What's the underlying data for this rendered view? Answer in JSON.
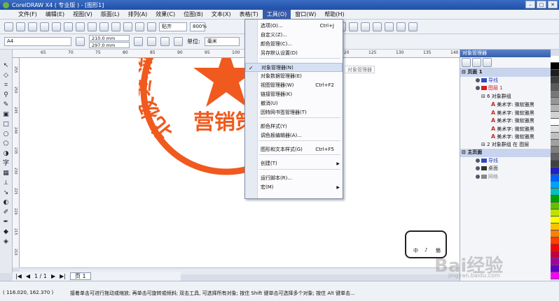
{
  "window": {
    "title": "CorelDRAW X4 ( 专业版 ) - [图形1]"
  },
  "menubar": {
    "items": [
      {
        "label": "文件(F)"
      },
      {
        "label": "编辑(E)"
      },
      {
        "label": "视图(V)"
      },
      {
        "label": "版面(L)"
      },
      {
        "label": "排列(A)"
      },
      {
        "label": "效果(C)"
      },
      {
        "label": "位图(B)"
      },
      {
        "label": "文本(X)"
      },
      {
        "label": "表格(T)"
      },
      {
        "label": "工具(O)"
      },
      {
        "label": "窗口(W)"
      },
      {
        "label": "帮助(H)"
      }
    ]
  },
  "toolbar": {
    "snap_label": "贴齐",
    "zoom": "800%"
  },
  "property_bar": {
    "paper_size": "A4",
    "width": "210.0 mm",
    "height": "297.0 mm",
    "unit_label": "单位:",
    "unit_value": "毫米"
  },
  "ruler": {
    "top_ticks": [
      "65",
      "70",
      "75",
      "80",
      "85",
      "90",
      "95",
      "100",
      "105",
      "110",
      "115",
      "120",
      "125",
      "130",
      "135",
      "140"
    ],
    "left_ticks": [
      "255",
      "250",
      "245",
      "240",
      "235",
      "230",
      "225",
      "220",
      "215",
      "210"
    ]
  },
  "stamp": {
    "arc_text": "北极寒流服务",
    "bottom_text": "营销策划",
    "color": "#f05a1e"
  },
  "tools_menu": {
    "items": [
      {
        "label": "选项(O)...",
        "shortcut": "Ctrl+J"
      },
      {
        "label": "自定义(Z)..."
      },
      {
        "label": "颜色管理(C)..."
      },
      {
        "label": "另存默认设置(D)"
      },
      {
        "label": "对象管理器(N)",
        "checked": true
      },
      {
        "label": "对象数据管理器(E)"
      },
      {
        "label": "视图管理器(W)",
        "shortcut": "Ctrl+F2"
      },
      {
        "label": "链接管理器(K)"
      },
      {
        "label": "撤消(U)"
      },
      {
        "label": "因特网书签管理器(T)"
      },
      {
        "label": "颜色样式(Y)"
      },
      {
        "label": "调色板编辑器(A)..."
      },
      {
        "label": "图形和文本样式(G)",
        "shortcut": "Ctrl+F5"
      },
      {
        "label": "创建(T)",
        "submenu": true
      },
      {
        "label": "运行脚本(R)..."
      },
      {
        "label": "宏(M)",
        "submenu": true
      }
    ],
    "tooltip": "对象管理器"
  },
  "object_manager": {
    "title": "对象管理器",
    "rows": [
      {
        "label": "页面 1",
        "type": "group"
      },
      {
        "label": "导线",
        "type": "layer",
        "color": "#3048c0"
      },
      {
        "label": "图层 1",
        "type": "layer",
        "color": "#d02020"
      },
      {
        "label": "6 对象群组",
        "type": "node"
      },
      {
        "label": "美术字: 微软雅黑",
        "type": "text"
      },
      {
        "label": "美术字: 微软雅黑",
        "type": "text"
      },
      {
        "label": "美术字: 微软雅黑",
        "type": "text"
      },
      {
        "label": "美术字: 微软雅黑",
        "type": "text"
      },
      {
        "label": "美术字: 微软雅黑",
        "type": "text"
      },
      {
        "label": "2 对象群组 在 图层",
        "type": "node"
      },
      {
        "label": "主页面",
        "type": "group"
      },
      {
        "label": "导线",
        "type": "layer",
        "color": "#3048c0"
      },
      {
        "label": "桌面",
        "type": "layer",
        "color": "#333333"
      },
      {
        "label": "网格",
        "type": "layer",
        "color": "#888888"
      }
    ]
  },
  "page_nav": {
    "counter": "1 / 1",
    "tab": "页 1"
  },
  "status": {
    "coords": "( 116.020, 162.370 )",
    "hint": "接着单击可进行拖动或缩放; 再单击可旋转或倾斜; 双击工具, 可选择所有对象; 按住 Shift 键单击可选择多个对象; 按住 Alt 键单击..."
  },
  "palette": [
    "#ffffff",
    "#000000",
    "#1e1e1e",
    "#3c3c3c",
    "#5a5a5a",
    "#787878",
    "#969696",
    "#b4b4b4",
    "#d2d2d2",
    "#ffffff",
    "#e0e0e0",
    "#c0c0c0",
    "#a0a0a0",
    "#808080",
    "#606060",
    "#404040",
    "#2020c0",
    "#0060ff",
    "#00a0ff",
    "#00c0c0",
    "#00a000",
    "#60c000",
    "#c0e000",
    "#ffff00",
    "#ffc000",
    "#ff8000",
    "#ff4000",
    "#ff0000",
    "#c00040",
    "#a000a0",
    "#6000c0",
    "#ff00ff"
  ],
  "mascot": {
    "labels": [
      "中",
      "♪",
      "簡"
    ]
  },
  "watermark": {
    "text": "Bai经验",
    "sub": "jingyan.baidu.com"
  }
}
